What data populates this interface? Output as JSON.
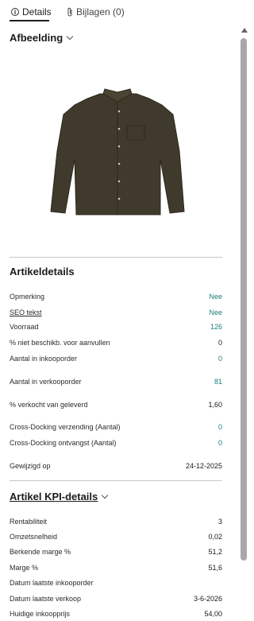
{
  "tabs": {
    "details_label": "Details",
    "attachments_label": "Bijlagen (0)"
  },
  "image_section": {
    "title": "Afbeelding"
  },
  "article_details": {
    "title": "Artikeldetails",
    "rows": [
      {
        "label": "Opmerking",
        "value": "Nee"
      },
      {
        "label": "SEO tekst",
        "value": "Nee"
      },
      {
        "label": "Voorraad",
        "value": "126"
      },
      {
        "label": "% niet beschikb. voor aanvullen",
        "value": "0"
      },
      {
        "label": "Aantal in inkooporder",
        "value": "0"
      },
      {
        "label": "Aantal in verkooporder",
        "value": "81"
      },
      {
        "label": "% verkocht van geleverd",
        "value": "1,60"
      },
      {
        "label": "Cross-Docking verzending (Aantal)",
        "value": "0"
      },
      {
        "label": "Cross-Docking ontvangst (Aantal)",
        "value": "0"
      },
      {
        "label": "Gewijzigd op",
        "value": "24-12-2025"
      }
    ]
  },
  "kpi_details": {
    "title": "Artikel KPI-details",
    "rows": [
      {
        "label": "Rentabiliteit",
        "value": "3"
      },
      {
        "label": "Omzetsnelheid",
        "value": "0,02"
      },
      {
        "label": "Berkende marge %",
        "value": "51,2"
      },
      {
        "label": "Marge %",
        "value": "51,6"
      },
      {
        "label": "Datum laatste inkooporder",
        "value": ""
      },
      {
        "label": "Datum laatste verkoop",
        "value": "3-6-2026"
      },
      {
        "label": "Huidige inkoopprijs",
        "value": "54,00"
      }
    ]
  },
  "colors": {
    "link": "#1a7f7a",
    "shirt": "#3f3a2b"
  },
  "icons": {
    "details_tab": "info-icon",
    "attachments_tab": "paperclip-icon",
    "section_toggle": "chevron-down-icon"
  }
}
